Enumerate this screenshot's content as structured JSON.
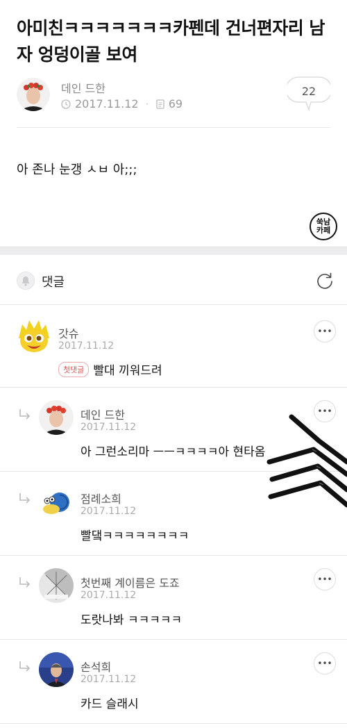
{
  "post": {
    "title": "아미친ㅋㅋㅋㅋㅋㅋㅋ카펜데 건너편자리 남자 엉덩이골 보여",
    "author": "데인 드한",
    "date": "2017.11.12",
    "views": "69",
    "comment_count": "22",
    "body": "아 존나 눈갱 ㅅㅂ 아;;;",
    "cafe_logo": [
      "쑥남",
      "카페"
    ]
  },
  "comments_section": {
    "title": "댓글"
  },
  "comments": [
    {
      "name": "갓슈",
      "date": "2017.11.12",
      "badge": "첫댓글",
      "text": "빨대 끼워드려"
    },
    {
      "name": "데인 드한",
      "date": "2017.11.12",
      "text": "아 그런소리마 ㅡㅡㅋㅋㅋㅋ아 현타옴"
    },
    {
      "name": "점례소희",
      "date": "2017.11.12",
      "text": "빨댘ㅋㅋㅋㅋㅋㅋㅋㅋ"
    },
    {
      "name": "첫번째 계이름은 도죠",
      "date": "2017.11.12",
      "text": "도랏나봐 ㅋㅋㅋㅋㅋ"
    },
    {
      "name": "손석희",
      "date": "2017.11.12",
      "text": "카드 슬래시"
    }
  ],
  "icons": {
    "clock": "clock-icon",
    "views": "document-icon",
    "bubble": "speech-bubble-icon",
    "bell": "bell-icon",
    "refresh": "refresh-icon",
    "more": "more-dots-icon",
    "reply": "reply-arrow-icon"
  },
  "colors": {
    "badge": "#e05050",
    "divider_band": "#ececef"
  }
}
